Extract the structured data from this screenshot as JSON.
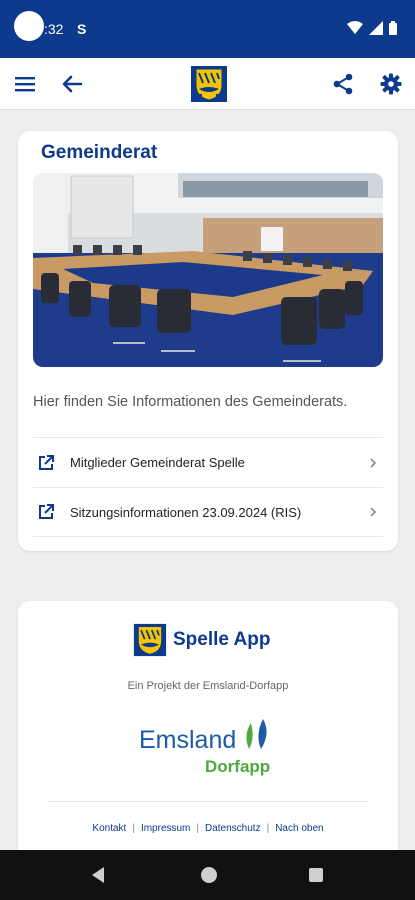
{
  "status_bar": {
    "time": ":32",
    "notification_glyph": "S",
    "icons": [
      "wifi-icon",
      "signal-icon",
      "battery-icon"
    ]
  },
  "app_bar": {
    "icons": [
      "menu-icon",
      "back-arrow-icon",
      "coat-of-arms-logo",
      "share-icon",
      "settings-icon"
    ]
  },
  "council_card": {
    "title": "Gemeinderat",
    "description": "Hier finden Sie Informationen des Gemeinderats.",
    "links": [
      {
        "label": "Mitglieder Gemeinderat Spelle",
        "icon": "external-link-icon"
      },
      {
        "label": "Sitzungsinformationen 23.09.2024 (RIS)",
        "icon": "external-link-icon"
      }
    ]
  },
  "footer": {
    "brand": "Spelle App",
    "subtitle": "Ein Projekt der Emsland-Dorfapp",
    "partner_logo_line1": "Emsland",
    "partner_logo_line2": "Dorfapp",
    "links": [
      "Kontakt",
      "Impressum",
      "Datenschutz",
      "Nach oben"
    ]
  },
  "colors": {
    "primary": "#0d3a8c",
    "background": "#eeeeee",
    "emsland_blue": "#1c5ba8",
    "emsland_green": "#4fa83d"
  }
}
